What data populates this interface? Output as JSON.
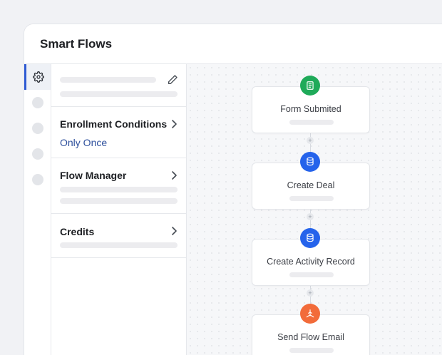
{
  "header": {
    "title": "Smart Flows"
  },
  "rail": {
    "active_icon": "gear-icon"
  },
  "panel": {
    "enrollment": {
      "label": "Enrollment Conditions",
      "value": "Only Once"
    },
    "flow_manager": {
      "label": "Flow Manager"
    },
    "credits": {
      "label": "Credits"
    }
  },
  "flow": {
    "nodes": [
      {
        "label": "Form Submited",
        "icon": "document-icon",
        "color": "#1faa59"
      },
      {
        "label": "Create Deal",
        "icon": "database-icon",
        "color": "#2563eb"
      },
      {
        "label": "Create Activity Record",
        "icon": "database-icon",
        "color": "#2563eb"
      },
      {
        "label": "Send Flow Email",
        "icon": "send-icon",
        "color": "#f26b3a"
      }
    ]
  },
  "colors": {
    "accent": "#2f5bd3",
    "value_text": "#2d4f9c"
  }
}
